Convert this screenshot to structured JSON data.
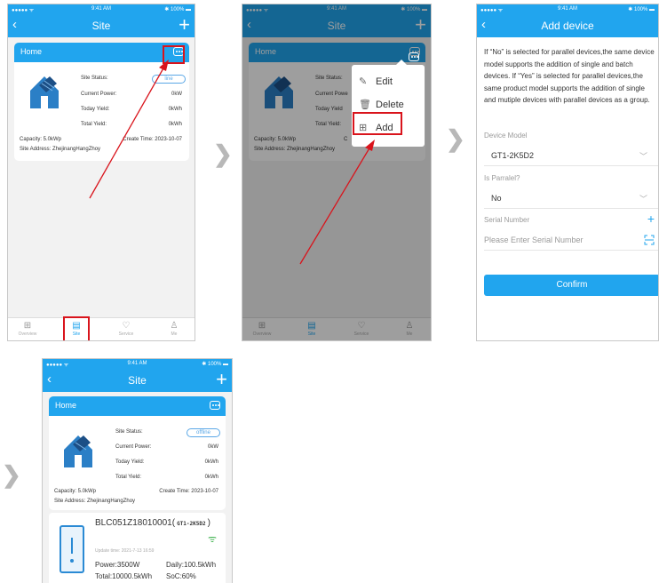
{
  "status": {
    "carrier": "●●●●● ᯤ",
    "time": "9:41 AM",
    "battery": "✱ 100% ▬"
  },
  "colors": {
    "accent": "#21a5ee",
    "highlight": "#d9141c",
    "status_badge": "#5aa7e6",
    "wifi": "#3fb24f"
  },
  "site_screen": {
    "title": "Site",
    "card": {
      "name": "Home",
      "status_label": "Site Status:",
      "status_value": "offline",
      "status_value_obscured": "line",
      "power_label": "Current Power:",
      "power_value": "0kW",
      "today_label": "Today Yield:",
      "today_value": "0kWh",
      "total_label": "Total Yield:",
      "total_value": "0kWh",
      "capacity": "Capacity: 5.0kWp",
      "create_time": "Create Time: 2023-10-07",
      "address": "Site Address: ZhejinangHangZhoy",
      "capacity_short": "Capacity: 5.0kWp",
      "create_time_obscured": "C",
      "power_label_obscured": "Current Powe",
      "today_label_obscured": "Today Yield",
      "total_label_obscured": "Total Yield:"
    },
    "tabs": [
      {
        "label": "Overview",
        "icon": "grid-icon"
      },
      {
        "label": "Site",
        "icon": "site-icon"
      },
      {
        "label": "Service",
        "icon": "heart-icon"
      },
      {
        "label": "Me",
        "icon": "person-icon"
      }
    ],
    "menu": {
      "edit": "Edit",
      "delete": "Delete",
      "add": "Add"
    }
  },
  "add_device": {
    "title": "Add device",
    "description": "If “No” is selected for parallel devices,the same device model supports the addition of single and batch devices. If “Yes” is selected for parallel devices,the same product model supports the addition of single and mutiple devices with parallel devices as a group.",
    "model_label": "Device Model",
    "model_value": "GT1-2K5D2",
    "parallel_label": "Is Parralel?",
    "parallel_value": "No",
    "serial_label": "Serial Number",
    "serial_placeholder": "Please Enter Serial Number",
    "confirm": "Confirm"
  },
  "device": {
    "name": "BLC051Z18010001(",
    "model_tag": "GT1-2K5D2",
    "close_paren": ")",
    "update_time": "Update time:  2021-7-13 16:59",
    "power": "Power:3500W",
    "daily": "Daily:100.5kWh",
    "total": "Total:10000.5kWh",
    "soc": "SoC:60%"
  }
}
